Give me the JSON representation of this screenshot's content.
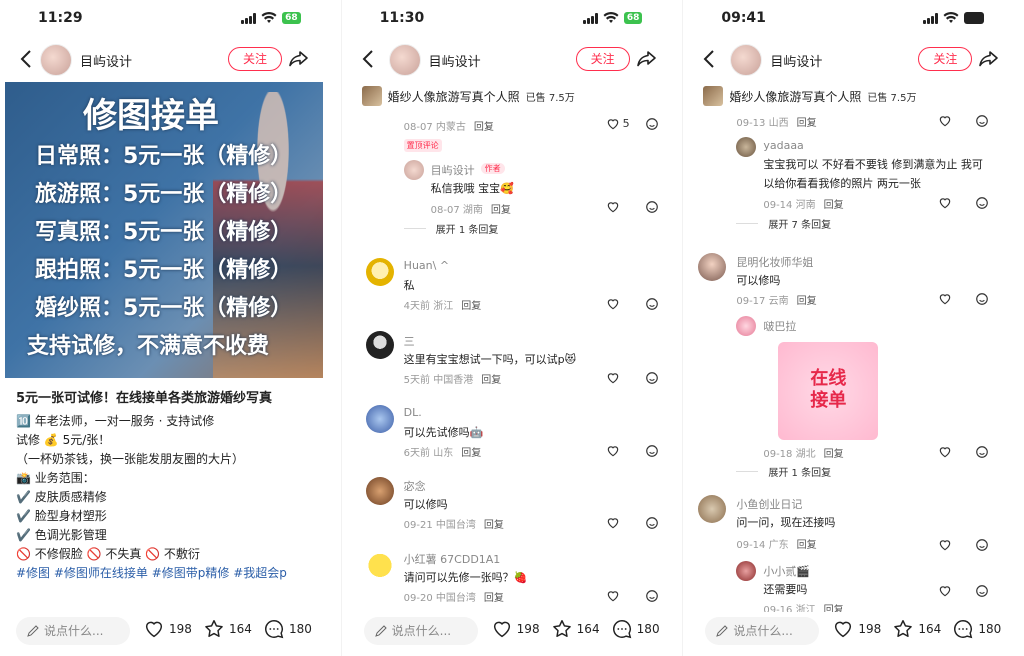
{
  "author": "目屿设计",
  "follow_label": "关注",
  "say_placeholder": "说点什么...",
  "counts": {
    "likes": "198",
    "stars": "164",
    "comments": "180"
  },
  "phones": [
    {
      "time": "11:29",
      "battery": "68"
    },
    {
      "time": "11:30",
      "battery": "68"
    },
    {
      "time": "09:41",
      "battery": ""
    }
  ],
  "poster": {
    "title": "修图接单",
    "lines": [
      "日常照：5元一张（精修）",
      "旅游照：5元一张（精修）",
      "写真照：5元一张（精修）",
      "跟拍照：5元一张（精修）",
      "婚纱照：5元一张（精修）",
      "支持试修，不满意不收费"
    ]
  },
  "post": {
    "title": "5元一张可试修！在线接单各类旅游婚纱写真",
    "lines": [
      "🔟 年老法师，一对一服务 · 支持试修",
      "试修 💰 5元/张！",
      "（一杯奶茶钱，换一张能发朋友圈的大片）",
      "📸 业务范围：",
      "✔️ 皮肤质感精修",
      "✔️ 脸型身材塑形",
      "✔️ 色调光影管理",
      "🚫 不修假脸 🚫 不失真 🚫 不敷衍"
    ],
    "tags": "#修图 #修图师在线接单 #修图带p精修 #我超会p"
  },
  "product": {
    "name": "婚纱人像旅游写真个人照",
    "sold": "已售 7.5万"
  },
  "reply_label": "回复",
  "c2": {
    "top_meta": "08-07 内蒙古",
    "top_likes": "5",
    "pinned": "置顶评论",
    "author_tag": "作者",
    "author_reply": "私信我哦 宝宝🥰",
    "author_meta": "08-07 湖南",
    "expand1": "展开 1 条回复",
    "comments": [
      {
        "name": "Huan\\ ^",
        "text": "私",
        "meta": "4天前 浙江"
      },
      {
        "name": "三",
        "text": "这里有宝宝想试一下吗，可以试p😻",
        "meta": "5天前 中国香港"
      },
      {
        "name": "DL.",
        "text": "可以先试修吗🤖",
        "meta": "6天前 山东"
      },
      {
        "name": "宓念",
        "text": "可以修吗",
        "meta": "09-21 中国台湾"
      },
      {
        "name": "小红薯 67CDD1A1",
        "text": "请问可以先修一张吗？🍓",
        "meta": "09-20 中国台湾"
      }
    ]
  },
  "c3": {
    "top_meta": "09-13 山西",
    "r1_name": "yadaaa",
    "r1_text1": "宝宝我可以 不好看不要钱 修到满意为止 我可",
    "r1_text2": "以给你看看我修的照片 两元一张",
    "r1_meta": "09-14 河南",
    "expand7": "展开 7 条回复",
    "c1_name": "昆明化妆师华姐",
    "c1_text": "可以修吗",
    "c1_meta": "09-17 云南",
    "r2_name": "啵巴拉",
    "sticker_text": "在线接单",
    "r2_meta": "09-18 湖北",
    "expand1": "展开 1 条回复",
    "c2_name": "小鱼创业日记",
    "c2_text": "问一问，现在还接吗",
    "c2_meta": "09-14 广东",
    "r3_name": "小小贰🎬",
    "r3_text": "还需要吗",
    "r3_meta": "09-16 浙江"
  }
}
